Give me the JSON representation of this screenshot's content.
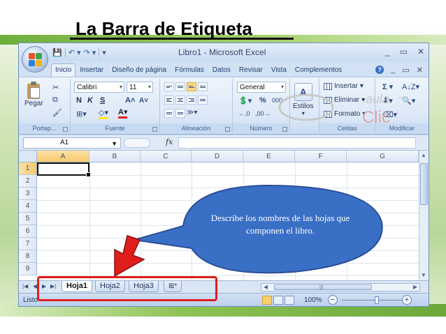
{
  "slide": {
    "title": "La Barra de Etiqueta",
    "callout_text": "Describe  los nombres de las hojas que componen el libro."
  },
  "window": {
    "title": "Libro1 - Microsoft Excel",
    "controls": [
      "_",
      "▭",
      "✕"
    ],
    "doc_controls": [
      "_",
      "▭",
      "✕"
    ]
  },
  "quick_access": {
    "save_icon": "save-icon",
    "undo_icon": "undo-icon",
    "redo_icon": "redo-icon"
  },
  "ribbon_tabs": [
    "Inicio",
    "Insertar",
    "Diseño de página",
    "Fórmulas",
    "Datos",
    "Revisar",
    "Vista",
    "Complementos"
  ],
  "ribbon": {
    "portapapeles": {
      "label": "Portap...",
      "paste": "Pegar"
    },
    "fuente": {
      "label": "Fuente",
      "font_name": "Calibri",
      "font_size": "11",
      "bold": "N",
      "italic": "K",
      "underline": "S"
    },
    "alineacion": {
      "label": "Alineación"
    },
    "numero": {
      "label": "Número",
      "format": "General",
      "percent": "%",
      "thousands": "000"
    },
    "estilos": {
      "label": "Estilos"
    },
    "celdas": {
      "label": "Celdas",
      "insert": "Insertar",
      "delete": "Eliminar",
      "format": "Formato"
    },
    "modificar": {
      "label": "Modificar"
    }
  },
  "formula_bar": {
    "cell_ref": "A1",
    "fx": "fx"
  },
  "watermark": {
    "text1": "aula",
    "text2": "Clic",
    "small": "com"
  },
  "columns": [
    "A",
    "B",
    "C",
    "D",
    "E",
    "F",
    "G"
  ],
  "rows": [
    "1",
    "2",
    "3",
    "4",
    "5",
    "6",
    "7",
    "8",
    "9"
  ],
  "sheet_tabs": [
    "Hoja1",
    "Hoja2",
    "Hoja3"
  ],
  "status_bar": {
    "text": "Listo",
    "zoom": "100%"
  },
  "colors": {
    "accent_red": "#e01e1e",
    "callout_blue": "#3a6fc6",
    "selection": "#f6c86a"
  }
}
